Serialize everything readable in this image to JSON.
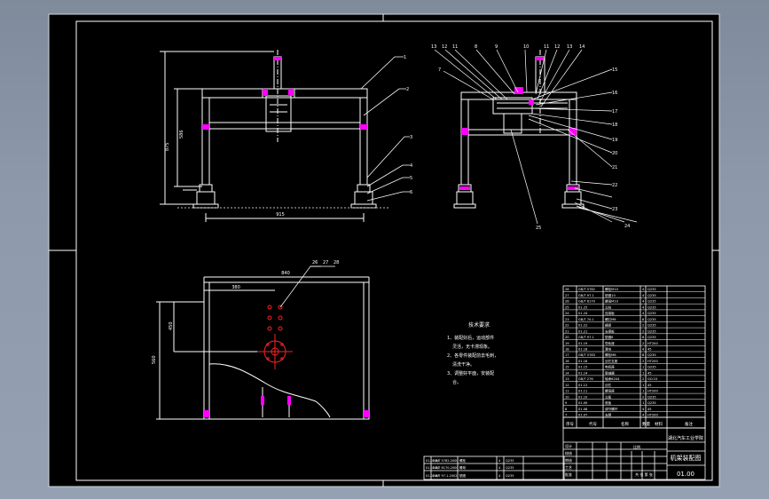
{
  "drawing": {
    "title": "机架装配图",
    "drawing_no": "01.00",
    "school": "湖北汽车工业学院"
  },
  "technical_requirements": {
    "heading": "技术要求",
    "lines": [
      "1、装配好后，运动部件",
      "灵活，无卡滞现象。",
      "2、各零件装配前去毛刺，",
      "清洗干净。",
      "3、调整好平面，安装配",
      "合。"
    ]
  },
  "dimensions": {
    "front_width": "915",
    "front_height": "586",
    "front_total_height": "875",
    "plan_width": "840",
    "plan_inner": "380",
    "plan_depth": "560",
    "plan_side": "450"
  },
  "balloons": {
    "front_right": [
      "1",
      "2",
      "3",
      "4",
      "5",
      "6"
    ],
    "side_top": [
      "13",
      "12",
      "11",
      "8",
      "9",
      "10",
      "11",
      "12",
      "13",
      "14"
    ],
    "side_left": [
      "7"
    ],
    "side_right": [
      "15",
      "16",
      "17",
      "18",
      "19",
      "20",
      "21",
      "22",
      "23",
      "24"
    ],
    "side_bottom": [
      "25"
    ],
    "plan_top": [
      "26",
      "27",
      "28"
    ]
  },
  "bom": {
    "header": [
      "序号",
      "代号",
      "名称",
      "数量",
      "材料",
      "备注"
    ],
    "rows": [
      [
        "28",
        "GB/T 5782",
        "螺栓M10",
        "4",
        "Q235"
      ],
      [
        "27",
        "GB/T 97.1",
        "垫圈10",
        "4",
        "Q235"
      ],
      [
        "26",
        "GB/T 6170",
        "螺母M10",
        "4",
        "Q235"
      ],
      [
        "25",
        "01.25",
        "立柱",
        "4",
        "Q235"
      ],
      [
        "24",
        "01.24",
        "连接板",
        "4",
        "Q235"
      ],
      [
        "23",
        "GB/T 70.1",
        "螺钉M8",
        "8",
        "Q235"
      ],
      [
        "22",
        "01.22",
        "横梁",
        "2",
        "Q235"
      ],
      [
        "21",
        "01.21",
        "支撑板",
        "2",
        "Q235"
      ],
      [
        "20",
        "GB/T 97.1",
        "垫圈8",
        "8",
        "Q235"
      ],
      [
        "19",
        "01.19",
        "导轨座",
        "2",
        "HT200"
      ],
      [
        "18",
        "01.18",
        "滑块",
        "4",
        "45"
      ],
      [
        "17",
        "GB/T 5783",
        "螺栓M8",
        "8",
        "Q235"
      ],
      [
        "16",
        "01.16",
        "丝杠支座",
        "2",
        "HT200"
      ],
      [
        "15",
        "01.15",
        "电机座",
        "1",
        "Q235"
      ],
      [
        "14",
        "01.14",
        "联轴器",
        "1",
        "45"
      ],
      [
        "13",
        "GB/T 276",
        "轴承6204",
        "2",
        "GCr15"
      ],
      [
        "12",
        "01.12",
        "丝杠",
        "1",
        "45"
      ],
      [
        "11",
        "01.11",
        "螺母座",
        "1",
        "HT200"
      ],
      [
        "10",
        "01.10",
        "立板",
        "2",
        "Q235"
      ],
      [
        "9",
        "01.09",
        "底板",
        "1",
        "Q235"
      ],
      [
        "8",
        "01.08",
        "调节螺杆",
        "4",
        "45"
      ],
      [
        "7",
        "01.07",
        "支脚",
        "4",
        "HT200"
      ]
    ]
  },
  "title_block": {
    "label_school": "湖北汽车工业学院",
    "label_scale": "比例",
    "label_sheet": "共 张 第 张",
    "sign_rows": [
      "设计",
      "校核",
      "审核",
      "工艺",
      "批准"
    ]
  },
  "left_block": {
    "rows": [
      [
        "01.02.01",
        "GB/T 5782-2000",
        "螺栓",
        "4",
        "Q235"
      ],
      [
        "01.02.02",
        "GB/T 6170-2000",
        "螺母",
        "4",
        "Q235"
      ],
      [
        "01.02.03",
        "GB/T 97.1-2002",
        "垫圈",
        "4",
        "Q235"
      ]
    ]
  },
  "colors": {
    "paper": "#000000",
    "line": "#ffffff",
    "accent": "#ff00ff",
    "red": "#ff2020"
  }
}
